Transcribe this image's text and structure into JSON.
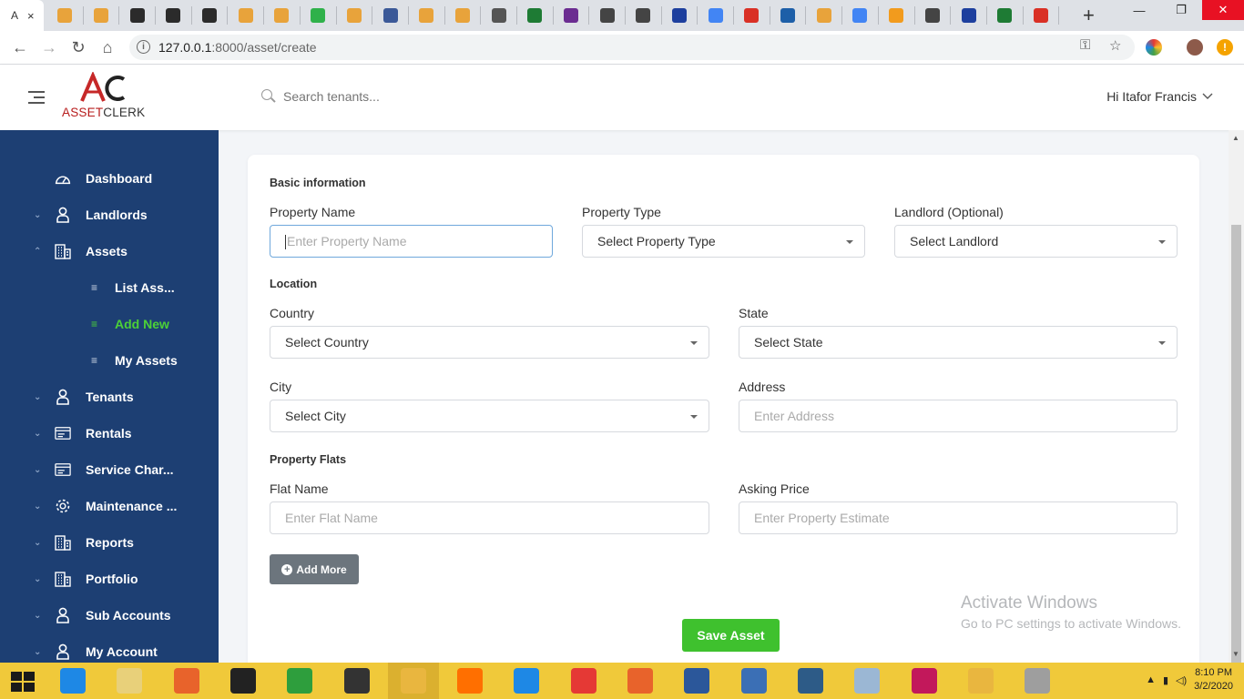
{
  "browser": {
    "tab_title": "A",
    "tab_close": "×",
    "url_host": "127.0.0.1",
    "url_path": ":8000/asset/create",
    "new_tab": "+",
    "win_minimize": "—",
    "win_restore": "❐",
    "win_close": "✕",
    "tab_icon_colors": [
      "#e8a33b",
      "#e8a33b",
      "#2b2b2b",
      "#2b2b2b",
      "#2b2b2b",
      "#e8a33b",
      "#e8a33b",
      "#2fb14a",
      "#e8a33b",
      "#3b5998",
      "#e8a33b",
      "#e8a33b",
      "#555555",
      "#1e7b34",
      "#6b2c91",
      "#444444",
      "#444444",
      "#1d3f9e",
      "#4285f4",
      "#d93025",
      "#1d5fa8",
      "#e8a33b",
      "#4285f4",
      "#f29b1d",
      "#444444",
      "#1d3f9e",
      "#1e7b34",
      "#d93025"
    ]
  },
  "header": {
    "logo_mark": "AC",
    "logo_red": "ASSET",
    "logo_dark": "CLERK",
    "search_placeholder": "Search tenants...",
    "user_greeting": "Hi Itafor Francis",
    "user_caret": "⌄"
  },
  "sidebar": {
    "items": [
      {
        "label": "Dashboard",
        "icon": "dashboard-icon",
        "chevron": ""
      },
      {
        "label": "Landlords",
        "icon": "user-icon",
        "chevron": "⌄"
      },
      {
        "label": "Assets",
        "icon": "building-icon",
        "chevron": "⌃"
      },
      {
        "label": "List Ass...",
        "icon": "list-icon",
        "chevron": ""
      },
      {
        "label": "Add New",
        "icon": "list-icon",
        "chevron": ""
      },
      {
        "label": "My Assets",
        "icon": "list-icon",
        "chevron": ""
      },
      {
        "label": "Tenants",
        "icon": "user-icon",
        "chevron": "⌄"
      },
      {
        "label": "Rentals",
        "icon": "card-icon",
        "chevron": "⌄"
      },
      {
        "label": "Service Char...",
        "icon": "card-icon",
        "chevron": "⌄"
      },
      {
        "label": "Maintenance ...",
        "icon": "gear-icon",
        "chevron": "⌄"
      },
      {
        "label": "Reports",
        "icon": "building-icon",
        "chevron": "⌄"
      },
      {
        "label": "Portfolio",
        "icon": "building-icon",
        "chevron": "⌄"
      },
      {
        "label": "Sub Accounts",
        "icon": "user-icon",
        "chevron": "⌄"
      },
      {
        "label": "My Account",
        "icon": "user-icon",
        "chevron": "⌄"
      }
    ],
    "bullet": "≡"
  },
  "form": {
    "section_basic": "Basic information",
    "property_name_label": "Property Name",
    "property_name_placeholder": "Enter Property Name",
    "property_type_label": "Property Type",
    "property_type_value": "Select Property Type",
    "landlord_label": "Landlord (Optional)",
    "landlord_value": "Select Landlord",
    "section_location": "Location",
    "country_label": "Country",
    "country_value": "Select Country",
    "state_label": "State",
    "state_value": "Select State",
    "city_label": "City",
    "city_value": "Select City",
    "address_label": "Address",
    "address_placeholder": "Enter Address",
    "section_flats": "Property Flats",
    "flat_name_label": "Flat Name",
    "flat_name_placeholder": "Enter Flat Name",
    "asking_price_label": "Asking Price",
    "asking_price_placeholder": "Enter Property Estimate",
    "add_more_label": "Add More",
    "add_more_icon": "+",
    "save_label": "Save Asset"
  },
  "watermark": {
    "line1": "Activate Windows",
    "line2": "Go to PC settings to activate Windows."
  },
  "taskbar": {
    "app_colors": [
      "#1e88e5",
      "#e8d07a",
      "#e8632b",
      "#222222",
      "#2e9e3d",
      "#333333",
      "#e9b63f",
      "#ff6f00",
      "#1e88e5",
      "#e53935",
      "#e8632b",
      "#2b579a",
      "#3b6fb5",
      "#2d5b87",
      "#9bb7d4",
      "#c2185b",
      "#e9b63f",
      "#9e9e9e"
    ],
    "time": "8:10 PM",
    "date": "3/2/2020"
  },
  "colors": {
    "sidebar_bg": "#1d3f73",
    "active_green": "#4cd137",
    "save_green": "#3fc12e",
    "brand_red": "#b71c1c"
  }
}
